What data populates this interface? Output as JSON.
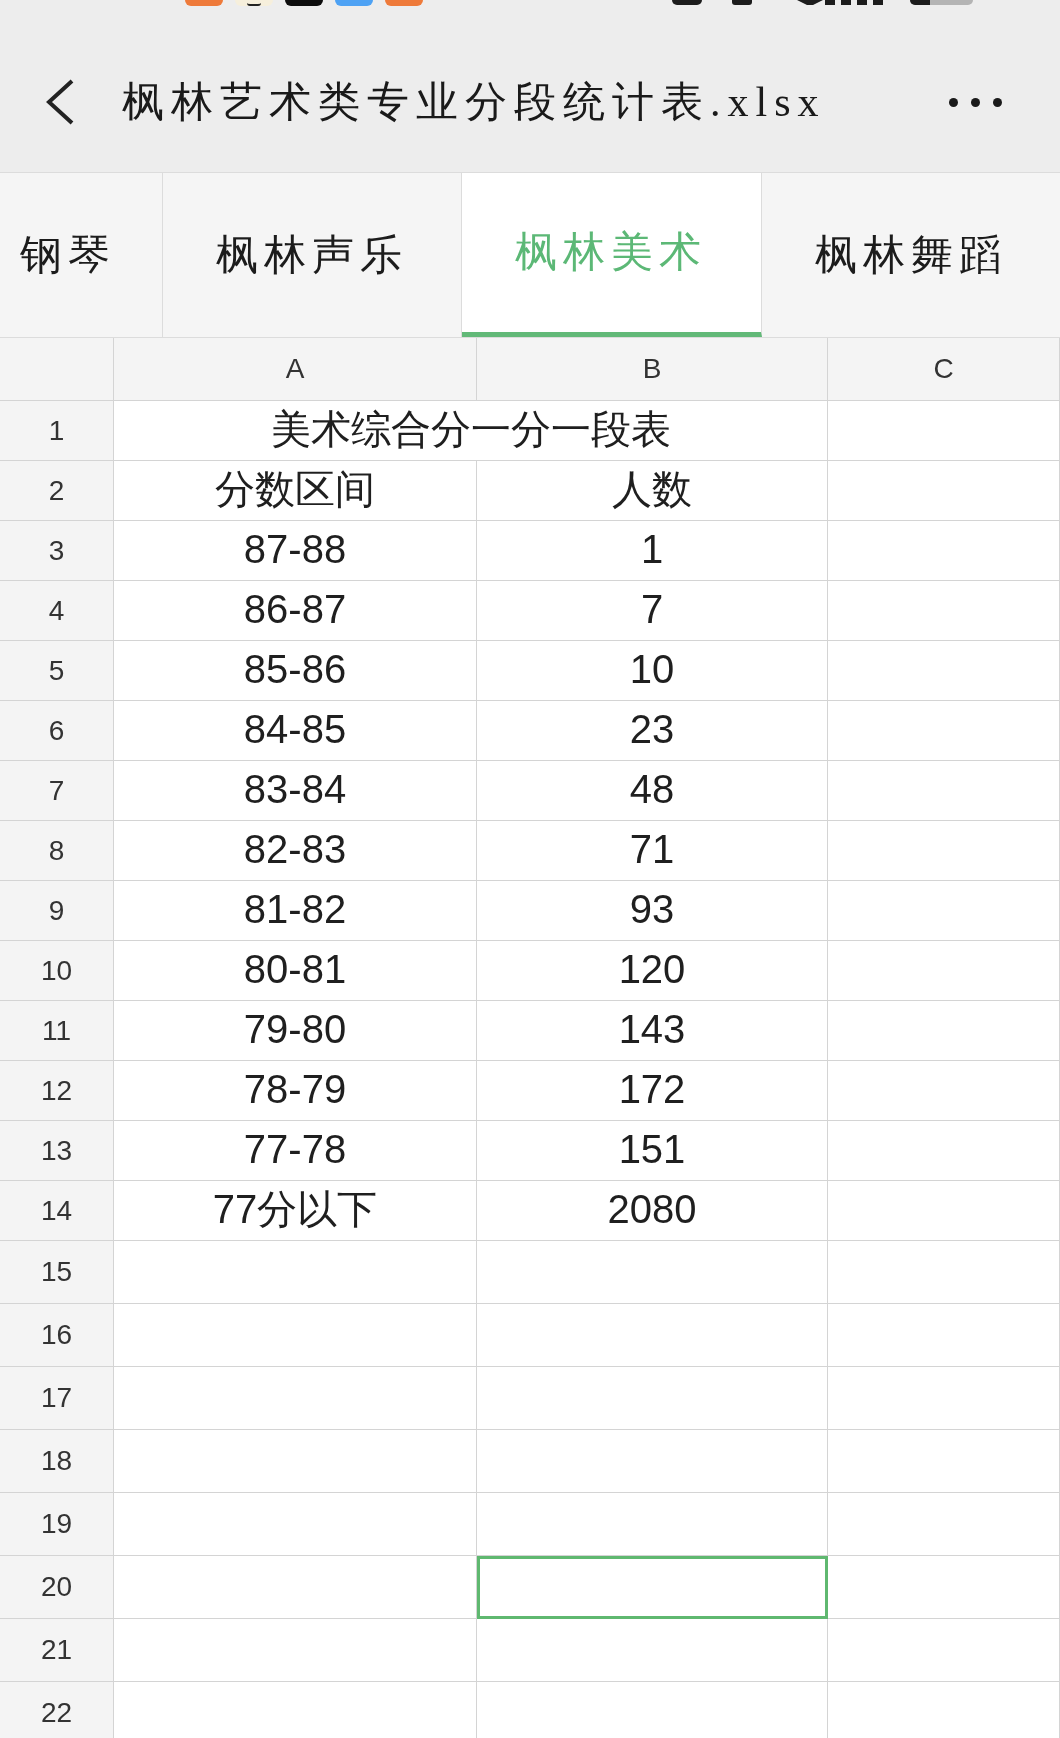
{
  "title_bar": {
    "title": "枫林艺术类专业分段统计表.xlsx"
  },
  "sheet_tabs": [
    {
      "label": "钢琴",
      "selected": false
    },
    {
      "label": "枫林声乐",
      "selected": false
    },
    {
      "label": "枫林美术",
      "selected": true
    },
    {
      "label": "枫林舞蹈",
      "selected": false
    }
  ],
  "sheet": {
    "columns": [
      "A",
      "B",
      "C"
    ],
    "rows": [
      {
        "number": "1",
        "kind": "title",
        "cells": [
          {
            "value": "美术综合分一分一段表",
            "selected": false
          },
          {
            "selected": false
          }
        ]
      },
      {
        "number": "2",
        "kind": "data",
        "cells": [
          {
            "value": "分数区间",
            "selected": false
          },
          {
            "value": "人数",
            "selected": false
          },
          {
            "selected": false
          }
        ]
      },
      {
        "number": "3",
        "kind": "data",
        "cells": [
          {
            "value": "87-88",
            "selected": false
          },
          {
            "value": "1",
            "selected": false
          },
          {
            "selected": false
          }
        ]
      },
      {
        "number": "4",
        "kind": "data",
        "cells": [
          {
            "value": "86-87",
            "selected": false
          },
          {
            "value": "7",
            "selected": false
          },
          {
            "selected": false
          }
        ]
      },
      {
        "number": "5",
        "kind": "data",
        "cells": [
          {
            "value": "85-86",
            "selected": false
          },
          {
            "value": "10",
            "selected": false
          },
          {
            "selected": false
          }
        ]
      },
      {
        "number": "6",
        "kind": "data",
        "cells": [
          {
            "value": "84-85",
            "selected": false
          },
          {
            "value": "23",
            "selected": false
          },
          {
            "selected": false
          }
        ]
      },
      {
        "number": "7",
        "kind": "data",
        "cells": [
          {
            "value": "83-84",
            "selected": false
          },
          {
            "value": "48",
            "selected": false
          },
          {
            "selected": false
          }
        ]
      },
      {
        "number": "8",
        "kind": "data",
        "cells": [
          {
            "value": "82-83",
            "selected": false
          },
          {
            "value": "71",
            "selected": false
          },
          {
            "selected": false
          }
        ]
      },
      {
        "number": "9",
        "kind": "data",
        "cells": [
          {
            "value": "81-82",
            "selected": false
          },
          {
            "value": "93",
            "selected": false
          },
          {
            "selected": false
          }
        ]
      },
      {
        "number": "10",
        "kind": "data",
        "cells": [
          {
            "value": "80-81",
            "selected": false
          },
          {
            "value": "120",
            "selected": false
          },
          {
            "selected": false
          }
        ]
      },
      {
        "number": "11",
        "kind": "data",
        "cells": [
          {
            "value": "79-80",
            "selected": false
          },
          {
            "value": "143",
            "selected": false
          },
          {
            "selected": false
          }
        ]
      },
      {
        "number": "12",
        "kind": "data",
        "cells": [
          {
            "value": "78-79",
            "selected": false
          },
          {
            "value": "172",
            "selected": false
          },
          {
            "selected": false
          }
        ]
      },
      {
        "number": "13",
        "kind": "data",
        "cells": [
          {
            "value": "77-78",
            "selected": false
          },
          {
            "value": "151",
            "selected": false
          },
          {
            "selected": false
          }
        ]
      },
      {
        "number": "14",
        "kind": "data",
        "cells": [
          {
            "value": "77分以下",
            "selected": false
          },
          {
            "value": "2080",
            "selected": false
          },
          {
            "selected": false
          }
        ]
      },
      {
        "number": "15",
        "kind": "data",
        "cells": [
          {
            "selected": false
          },
          {
            "selected": false
          },
          {
            "selected": false
          }
        ]
      },
      {
        "number": "16",
        "kind": "data",
        "cells": [
          {
            "selected": false
          },
          {
            "selected": false
          },
          {
            "selected": false
          }
        ]
      },
      {
        "number": "17",
        "kind": "data",
        "cells": [
          {
            "selected": false
          },
          {
            "selected": false
          },
          {
            "selected": false
          }
        ]
      },
      {
        "number": "18",
        "kind": "data",
        "cells": [
          {
            "selected": false
          },
          {
            "selected": false
          },
          {
            "selected": false
          }
        ]
      },
      {
        "number": "19",
        "kind": "data",
        "cells": [
          {
            "selected": false
          },
          {
            "selected": false
          },
          {
            "selected": false
          }
        ]
      },
      {
        "number": "20",
        "kind": "data",
        "cells": [
          {
            "selected": false
          },
          {
            "selected": true
          },
          {
            "selected": false
          }
        ]
      },
      {
        "number": "21",
        "kind": "data",
        "cells": [
          {
            "selected": false
          },
          {
            "selected": false
          },
          {
            "selected": false
          }
        ]
      },
      {
        "number": "22",
        "kind": "data",
        "cells": [
          {
            "selected": false
          },
          {
            "selected": false
          },
          {
            "selected": false
          }
        ]
      }
    ]
  }
}
